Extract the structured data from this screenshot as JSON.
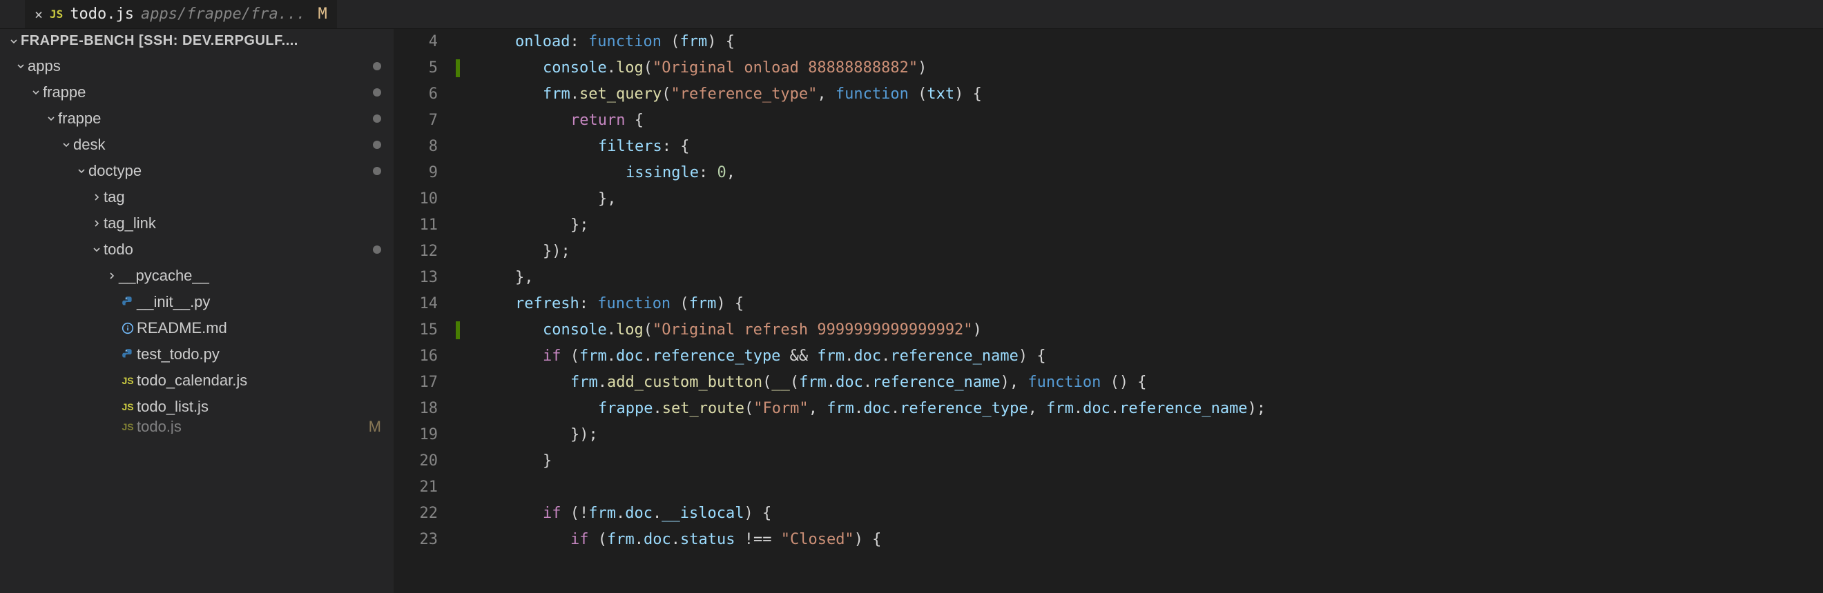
{
  "tab": {
    "lang": "JS",
    "filename": "todo.js",
    "path": "apps/frappe/fra...",
    "status": "M"
  },
  "tree": {
    "root": "FRAPPE-BENCH [SSH: DEV.ERPGULF....",
    "nodes": [
      {
        "name": "apps",
        "kind": "folder",
        "expanded": true,
        "depth": 0,
        "modified": true
      },
      {
        "name": "frappe",
        "kind": "folder",
        "expanded": true,
        "depth": 1,
        "modified": true
      },
      {
        "name": "frappe",
        "kind": "folder",
        "expanded": true,
        "depth": 2,
        "modified": true
      },
      {
        "name": "desk",
        "kind": "folder",
        "expanded": true,
        "depth": 3,
        "modified": true
      },
      {
        "name": "doctype",
        "kind": "folder",
        "expanded": true,
        "depth": 4,
        "modified": true
      },
      {
        "name": "tag",
        "kind": "folder",
        "expanded": false,
        "depth": 5
      },
      {
        "name": "tag_link",
        "kind": "folder",
        "expanded": false,
        "depth": 5
      },
      {
        "name": "todo",
        "kind": "folder",
        "expanded": true,
        "depth": 5,
        "modified": true
      },
      {
        "name": "__pycache__",
        "kind": "folder",
        "expanded": false,
        "depth": 6
      },
      {
        "name": "__init__.py",
        "kind": "file",
        "lang": "py",
        "depth": 6
      },
      {
        "name": "README.md",
        "kind": "file",
        "lang": "info",
        "depth": 6
      },
      {
        "name": "test_todo.py",
        "kind": "file",
        "lang": "py",
        "depth": 6
      },
      {
        "name": "todo_calendar.js",
        "kind": "file",
        "lang": "js",
        "depth": 6
      },
      {
        "name": "todo_list.js",
        "kind": "file",
        "lang": "js",
        "depth": 6
      },
      {
        "name": "todo.js",
        "kind": "file",
        "lang": "js",
        "depth": 6,
        "git": "M",
        "cutoff": true
      }
    ]
  },
  "editor": {
    "first_line_no": 4,
    "git_marks": [
      5,
      15
    ],
    "lines": [
      {
        "n": 4,
        "pad": 2,
        "tokens": [
          {
            "t": "onload",
            "c": "id"
          },
          {
            "t": ": ",
            "c": "delim"
          },
          {
            "t": "function",
            "c": "key"
          },
          {
            "t": " (",
            "c": "delim"
          },
          {
            "t": "frm",
            "c": "id"
          },
          {
            "t": ") {",
            "c": "delim"
          }
        ]
      },
      {
        "n": 5,
        "pad": 3,
        "tokens": [
          {
            "t": "console",
            "c": "id"
          },
          {
            "t": ".",
            "c": "delim"
          },
          {
            "t": "log",
            "c": "fn"
          },
          {
            "t": "(",
            "c": "delim"
          },
          {
            "t": "\"Original onload 88888888882\"",
            "c": "str"
          },
          {
            "t": ")",
            "c": "delim"
          }
        ]
      },
      {
        "n": 6,
        "pad": 3,
        "tokens": [
          {
            "t": "frm",
            "c": "id"
          },
          {
            "t": ".",
            "c": "delim"
          },
          {
            "t": "set_query",
            "c": "fn"
          },
          {
            "t": "(",
            "c": "delim"
          },
          {
            "t": "\"reference_type\"",
            "c": "str"
          },
          {
            "t": ", ",
            "c": "delim"
          },
          {
            "t": "function",
            "c": "key"
          },
          {
            "t": " (",
            "c": "delim"
          },
          {
            "t": "txt",
            "c": "id"
          },
          {
            "t": ") {",
            "c": "delim"
          }
        ]
      },
      {
        "n": 7,
        "pad": 4,
        "tokens": [
          {
            "t": "return",
            "c": "ctrl"
          },
          {
            "t": " {",
            "c": "delim"
          }
        ]
      },
      {
        "n": 8,
        "pad": 5,
        "tokens": [
          {
            "t": "filters",
            "c": "id"
          },
          {
            "t": ": {",
            "c": "delim"
          }
        ]
      },
      {
        "n": 9,
        "pad": 6,
        "tokens": [
          {
            "t": "issingle",
            "c": "id"
          },
          {
            "t": ": ",
            "c": "delim"
          },
          {
            "t": "0",
            "c": "num"
          },
          {
            "t": ",",
            "c": "delim"
          }
        ]
      },
      {
        "n": 10,
        "pad": 5,
        "tokens": [
          {
            "t": "},",
            "c": "delim"
          }
        ]
      },
      {
        "n": 11,
        "pad": 4,
        "tokens": [
          {
            "t": "};",
            "c": "delim"
          }
        ]
      },
      {
        "n": 12,
        "pad": 3,
        "tokens": [
          {
            "t": "});",
            "c": "delim"
          }
        ]
      },
      {
        "n": 13,
        "pad": 2,
        "tokens": [
          {
            "t": "},",
            "c": "delim"
          }
        ]
      },
      {
        "n": 14,
        "pad": 2,
        "tokens": [
          {
            "t": "refresh",
            "c": "id"
          },
          {
            "t": ": ",
            "c": "delim"
          },
          {
            "t": "function",
            "c": "key"
          },
          {
            "t": " (",
            "c": "delim"
          },
          {
            "t": "frm",
            "c": "id"
          },
          {
            "t": ") {",
            "c": "delim"
          }
        ]
      },
      {
        "n": 15,
        "pad": 3,
        "tokens": [
          {
            "t": "console",
            "c": "id"
          },
          {
            "t": ".",
            "c": "delim"
          },
          {
            "t": "log",
            "c": "fn"
          },
          {
            "t": "(",
            "c": "delim"
          },
          {
            "t": "\"Original refresh 9999999999999992\"",
            "c": "str"
          },
          {
            "t": ")",
            "c": "delim"
          }
        ]
      },
      {
        "n": 16,
        "pad": 3,
        "tokens": [
          {
            "t": "if",
            "c": "ctrl"
          },
          {
            "t": " (",
            "c": "delim"
          },
          {
            "t": "frm",
            "c": "id"
          },
          {
            "t": ".",
            "c": "delim"
          },
          {
            "t": "doc",
            "c": "id"
          },
          {
            "t": ".",
            "c": "delim"
          },
          {
            "t": "reference_type",
            "c": "id"
          },
          {
            "t": " && ",
            "c": "delim"
          },
          {
            "t": "frm",
            "c": "id"
          },
          {
            "t": ".",
            "c": "delim"
          },
          {
            "t": "doc",
            "c": "id"
          },
          {
            "t": ".",
            "c": "delim"
          },
          {
            "t": "reference_name",
            "c": "id"
          },
          {
            "t": ") {",
            "c": "delim"
          }
        ]
      },
      {
        "n": 17,
        "pad": 4,
        "tokens": [
          {
            "t": "frm",
            "c": "id"
          },
          {
            "t": ".",
            "c": "delim"
          },
          {
            "t": "add_custom_button",
            "c": "fn"
          },
          {
            "t": "(",
            "c": "delim"
          },
          {
            "t": "__",
            "c": "fn"
          },
          {
            "t": "(",
            "c": "delim"
          },
          {
            "t": "frm",
            "c": "id"
          },
          {
            "t": ".",
            "c": "delim"
          },
          {
            "t": "doc",
            "c": "id"
          },
          {
            "t": ".",
            "c": "delim"
          },
          {
            "t": "reference_name",
            "c": "id"
          },
          {
            "t": "), ",
            "c": "delim"
          },
          {
            "t": "function",
            "c": "key"
          },
          {
            "t": " () {",
            "c": "delim"
          }
        ]
      },
      {
        "n": 18,
        "pad": 5,
        "tokens": [
          {
            "t": "frappe",
            "c": "id"
          },
          {
            "t": ".",
            "c": "delim"
          },
          {
            "t": "set_route",
            "c": "fn"
          },
          {
            "t": "(",
            "c": "delim"
          },
          {
            "t": "\"Form\"",
            "c": "str"
          },
          {
            "t": ", ",
            "c": "delim"
          },
          {
            "t": "frm",
            "c": "id"
          },
          {
            "t": ".",
            "c": "delim"
          },
          {
            "t": "doc",
            "c": "id"
          },
          {
            "t": ".",
            "c": "delim"
          },
          {
            "t": "reference_type",
            "c": "id"
          },
          {
            "t": ", ",
            "c": "delim"
          },
          {
            "t": "frm",
            "c": "id"
          },
          {
            "t": ".",
            "c": "delim"
          },
          {
            "t": "doc",
            "c": "id"
          },
          {
            "t": ".",
            "c": "delim"
          },
          {
            "t": "reference_name",
            "c": "id"
          },
          {
            "t": ");",
            "c": "delim"
          }
        ]
      },
      {
        "n": 19,
        "pad": 4,
        "tokens": [
          {
            "t": "});",
            "c": "delim"
          }
        ]
      },
      {
        "n": 20,
        "pad": 3,
        "tokens": [
          {
            "t": "}",
            "c": "delim"
          }
        ]
      },
      {
        "n": 21,
        "pad": 0,
        "tokens": []
      },
      {
        "n": 22,
        "pad": 3,
        "tokens": [
          {
            "t": "if",
            "c": "ctrl"
          },
          {
            "t": " (!",
            "c": "delim"
          },
          {
            "t": "frm",
            "c": "id"
          },
          {
            "t": ".",
            "c": "delim"
          },
          {
            "t": "doc",
            "c": "id"
          },
          {
            "t": ".",
            "c": "delim"
          },
          {
            "t": "__islocal",
            "c": "id"
          },
          {
            "t": ") {",
            "c": "delim"
          }
        ]
      },
      {
        "n": 23,
        "pad": 4,
        "tokens": [
          {
            "t": "if",
            "c": "ctrl"
          },
          {
            "t": " (",
            "c": "delim"
          },
          {
            "t": "frm",
            "c": "id"
          },
          {
            "t": ".",
            "c": "delim"
          },
          {
            "t": "doc",
            "c": "id"
          },
          {
            "t": ".",
            "c": "delim"
          },
          {
            "t": "status",
            "c": "id"
          },
          {
            "t": " !== ",
            "c": "delim"
          },
          {
            "t": "\"Closed\"",
            "c": "str"
          },
          {
            "t": ") {",
            "c": "delim"
          }
        ]
      }
    ]
  }
}
